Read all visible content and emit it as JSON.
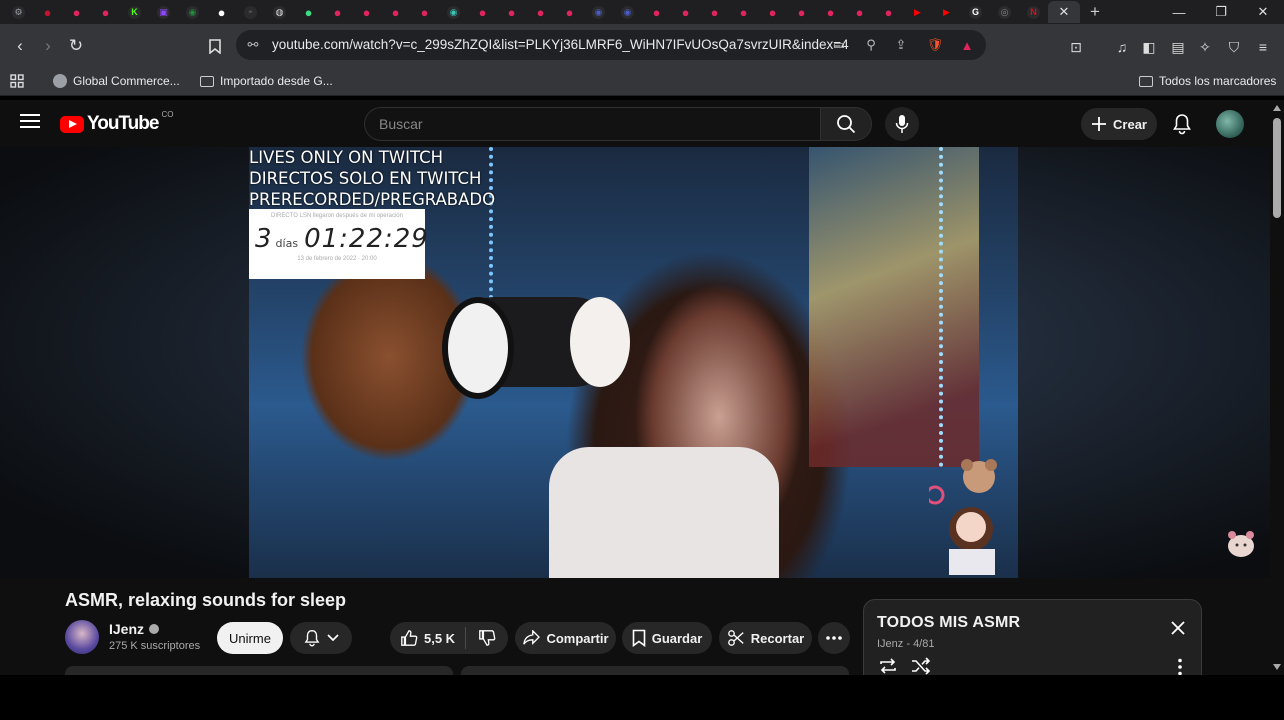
{
  "browser": {
    "tabs": [
      {
        "icon": "settings-favicon",
        "color": "#9aa0a6",
        "glyph": "⚙"
      },
      {
        "icon": "red-circle-favicon",
        "color": "#c4122f",
        "glyph": "●"
      },
      {
        "icon": "youtube-favicon",
        "color": "#e0245e",
        "glyph": "●"
      },
      {
        "icon": "youtube-favicon",
        "color": "#e0245e",
        "glyph": "●"
      },
      {
        "icon": "kick-favicon",
        "color": "#53fc18",
        "glyph": "K"
      },
      {
        "icon": "twitch-favicon",
        "color": "#9146ff",
        "glyph": "▣"
      },
      {
        "icon": "green-favicon",
        "color": "#1f8f3a",
        "glyph": "◉"
      },
      {
        "icon": "white-circle-favicon",
        "color": "#ffffff",
        "glyph": "●"
      },
      {
        "icon": "dark-favicon",
        "color": "#555555",
        "glyph": "◓"
      },
      {
        "icon": "white-favicon",
        "color": "#dddddd",
        "glyph": "◍"
      },
      {
        "icon": "green-favicon",
        "color": "#3ddc84",
        "glyph": "●"
      },
      {
        "icon": "youtube-favicon",
        "color": "#e0245e",
        "glyph": "●"
      },
      {
        "icon": "youtube-favicon",
        "color": "#e0245e",
        "glyph": "●"
      },
      {
        "icon": "youtube-favicon",
        "color": "#e0245e",
        "glyph": "●"
      },
      {
        "icon": "youtube-favicon",
        "color": "#e0245e",
        "glyph": "●"
      },
      {
        "icon": "teal-favicon",
        "color": "#3ac6b4",
        "glyph": "◉"
      },
      {
        "icon": "youtube-favicon",
        "color": "#e0245e",
        "glyph": "●"
      },
      {
        "icon": "youtube-favicon",
        "color": "#e0245e",
        "glyph": "●"
      },
      {
        "icon": "youtube-favicon",
        "color": "#e0245e",
        "glyph": "●"
      },
      {
        "icon": "youtube-favicon",
        "color": "#e0245e",
        "glyph": "●"
      },
      {
        "icon": "blue-favicon",
        "color": "#4b5cc4",
        "glyph": "◉"
      },
      {
        "icon": "blue-favicon",
        "color": "#4b5cc4",
        "glyph": "◉"
      },
      {
        "icon": "youtube-favicon",
        "color": "#e0245e",
        "glyph": "●"
      },
      {
        "icon": "youtube-favicon",
        "color": "#e0245e",
        "glyph": "●"
      },
      {
        "icon": "youtube-favicon",
        "color": "#e0245e",
        "glyph": "●"
      },
      {
        "icon": "youtube-favicon",
        "color": "#e0245e",
        "glyph": "●"
      },
      {
        "icon": "youtube-favicon",
        "color": "#e0245e",
        "glyph": "●"
      },
      {
        "icon": "youtube-favicon",
        "color": "#e0245e",
        "glyph": "●"
      },
      {
        "icon": "youtube-favicon",
        "color": "#e0245e",
        "glyph": "●"
      },
      {
        "icon": "youtube-favicon",
        "color": "#e0245e",
        "glyph": "●"
      },
      {
        "icon": "youtube-favicon",
        "color": "#e0245e",
        "glyph": "●"
      },
      {
        "icon": "youtube-play-favicon",
        "color": "#ff0000",
        "glyph": "▶"
      },
      {
        "icon": "youtube-play-favicon",
        "color": "#ff0000",
        "glyph": "▶"
      },
      {
        "icon": "google-favicon",
        "color": "#ffffff",
        "glyph": "G"
      },
      {
        "icon": "chrome-favicon",
        "color": "#888888",
        "glyph": "◎"
      },
      {
        "icon": "netflix-favicon",
        "color": "#e50914",
        "glyph": "N"
      }
    ],
    "active_tab_close": "✕",
    "new_tab": "+",
    "url": "youtube.com/watch?v=c_299sZhZQI&list=PLKYj36LMRF6_WiHN7IFvUOsQa7svrzUIR&index=4",
    "bookmarks": {
      "item1": "Global Commerce...",
      "item2": "Importado desde G...",
      "all": "Todos los marcadores"
    }
  },
  "youtube": {
    "logo_text": "YouTube",
    "country_code": "CO",
    "search_placeholder": "Buscar",
    "create_label": "Crear",
    "video": {
      "overlay_line1": "LIVES ONLY ON TWITCH",
      "overlay_line2": "DIRECTOS SOLO EN TWITCH",
      "overlay_line3": "PRERECORDED/PREGRABADO",
      "timer_top": "DIRECTO LSN llegaron después de mi operación",
      "timer_days": "3",
      "timer_days_label": "días",
      "timer_clock": "01:22:29",
      "timer_bottom": "13 de febrero de 2022 · 20:00"
    },
    "title": "ASMR, relaxing sounds for sleep",
    "channel": {
      "name": "IJenz",
      "subscribers": "275 K suscriptores",
      "join_label": "Unirme"
    },
    "actions": {
      "likes": "5,5 K",
      "share": "Compartir",
      "save": "Guardar",
      "clip": "Recortar"
    },
    "playlist": {
      "title": "TODOS MIS ASMR",
      "meta": "IJenz - 4/81"
    }
  },
  "colors": {
    "youtube_red": "#ff0000",
    "background": "#0f0f0f",
    "chip": "#272727"
  }
}
